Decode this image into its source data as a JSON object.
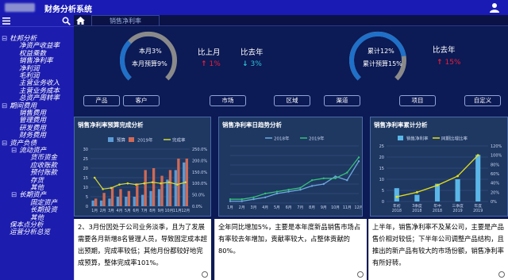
{
  "app": {
    "title": "财务分析系统"
  },
  "tabs": [
    {
      "label": "销售净利率"
    }
  ],
  "sidebar": {
    "items": [
      {
        "label": "杜邦分析",
        "toggle": "⊟",
        "level": 0
      },
      {
        "label": "净资产收益率",
        "level": 1
      },
      {
        "label": "权益乘数",
        "level": 1
      },
      {
        "label": "销售净利率",
        "level": 1
      },
      {
        "label": "净利润",
        "level": 1
      },
      {
        "label": "毛利润",
        "level": 1
      },
      {
        "label": "主营业务收入",
        "level": 1
      },
      {
        "label": "主营业务成本",
        "level": 1
      },
      {
        "label": "总资产周转率",
        "level": 1
      },
      {
        "label": "期间费用",
        "toggle": "⊟",
        "level": 0
      },
      {
        "label": "销售费用",
        "level": 1
      },
      {
        "label": "管理费用",
        "level": 1
      },
      {
        "label": "研发费用",
        "level": 1
      },
      {
        "label": "财务费用",
        "level": 1
      },
      {
        "label": "资产负债",
        "toggle": "⊟",
        "level": 0
      },
      {
        "label": "流动资产",
        "toggle": "⊟",
        "level": 1
      },
      {
        "label": "货币资金",
        "level": 2
      },
      {
        "label": "应收账款",
        "level": 2
      },
      {
        "label": "预付账款",
        "level": 2
      },
      {
        "label": "存货",
        "level": 2
      },
      {
        "label": "其他",
        "level": 2
      },
      {
        "label": "长期资产",
        "toggle": "⊟",
        "level": 1
      },
      {
        "label": "固定资产",
        "level": 2
      },
      {
        "label": "长期投资",
        "level": 2
      },
      {
        "label": "其他",
        "level": 2
      },
      {
        "label": "保本点分析",
        "level": 0
      },
      {
        "label": "运营分析总览",
        "level": 0
      }
    ]
  },
  "kpi_left": {
    "gauge_line1": "本月3%",
    "gauge_line2": "本月预算9%",
    "gauge_progress": 0.33,
    "cmp1_title": "比上月",
    "cmp1_value": "1%",
    "cmp1_dir": "up",
    "cmp2_title": "比去年",
    "cmp2_value": "3%",
    "cmp2_dir": "down"
  },
  "kpi_right": {
    "gauge_line1": "累计12%",
    "gauge_line2": "累计预算15%",
    "gauge_progress": 0.8,
    "cmp1_title": "比去年",
    "cmp1_value": "15%",
    "cmp1_dir": "up"
  },
  "colors": {
    "up": "#e8203a",
    "down": "#2ec3d8",
    "gauge_fill": "#1f70c8",
    "gauge_track": "#8a8a8a"
  },
  "filters": [
    {
      "label": "产品"
    },
    {
      "label": "客户"
    },
    {
      "label": "市场"
    },
    {
      "label": "区域"
    },
    {
      "label": "渠道"
    },
    {
      "label": "项目"
    },
    {
      "label": "自定义"
    }
  ],
  "chart_data": [
    {
      "type": "bar",
      "title": "销售净利率预算完成分析",
      "categories": [
        "1月",
        "2月",
        "3月",
        "4月",
        "5月",
        "6月",
        "7月",
        "8月",
        "9月",
        "10月",
        "11月",
        "12月"
      ],
      "series": [
        {
          "name": "预算",
          "values": [
            3,
            3,
            4,
            5,
            5,
            5,
            6,
            8,
            9,
            14,
            19,
            23
          ]
        },
        {
          "name": "2019年",
          "values": [
            4,
            7,
            10,
            9,
            8,
            12,
            19,
            20,
            16,
            19,
            25,
            25
          ]
        },
        {
          "name": "完成率",
          "values": [
            125,
            75,
            80,
            95,
            100,
            95,
            100,
            105,
            100,
            105,
            95,
            105
          ],
          "axis": "right"
        }
      ],
      "ylim": [
        0,
        30
      ],
      "y2lim": [
        0,
        250
      ],
      "yticks": [
        "0",
        "5",
        "10",
        "15",
        "20",
        "25",
        "30"
      ],
      "y2ticks": [
        "0.0%",
        "50.0%",
        "100.0%",
        "150.0%",
        "200.0%",
        "250.0%"
      ],
      "legend": "top"
    },
    {
      "type": "line",
      "title": "销售净利率日趋势分析",
      "x": [
        "1月",
        "2月",
        "3月",
        "4月",
        "5月",
        "6月",
        "7月",
        "8月",
        "9月",
        "10月",
        "11月",
        "12月"
      ],
      "series": [
        {
          "name": "2018年",
          "values": [
            1,
            1,
            2,
            3,
            5,
            6,
            7,
            9,
            10,
            14,
            12,
            22
          ]
        },
        {
          "name": "2019年",
          "values": [
            2,
            2,
            3,
            5,
            6,
            7,
            8,
            12,
            13,
            13,
            16,
            24
          ]
        }
      ],
      "ylim": [
        0,
        30
      ],
      "legend": "top"
    },
    {
      "type": "bar",
      "title": "销售净利率累计分析",
      "categories": [
        "年初\n2018",
        "3季度\n2018",
        "年中\n2018",
        "三季度\n2019",
        "年度\n2019"
      ],
      "series": [
        {
          "name": "销售净利率",
          "values": [
            6,
            3,
            8,
            10,
            21
          ]
        },
        {
          "name": "同期比增比率",
          "values": [
            10,
            20,
            35,
            55,
            100
          ],
          "axis": "right"
        }
      ],
      "ylim": [
        0,
        25
      ],
      "y2lim": [
        0,
        120
      ],
      "yticks": [
        "0",
        "5",
        "10",
        "15",
        "20",
        "25"
      ],
      "y2ticks": [
        "0%",
        "20%",
        "40%",
        "60%",
        "80%",
        "100%",
        "120%"
      ],
      "legend": "top"
    }
  ],
  "analysis": [
    {
      "text": "2、3月份因处于公司业务淡季，且为了发展需要各月新增8名管理人员，导致固定成本超出预期，完成率较低；其他月份都较好地完成预算，整体完成率101%。"
    },
    {
      "text": "全年同比增加5%，主要是本年度新品销售市场占有率较去年增加，贡献率较大，占整体贡献的80%。"
    },
    {
      "text": "上半年，销售净利率不及某公司，主要是产品售价相对较低；下半年公司调整产品结构，且推出的新产品有较大的市场份额，销售净利率有所好转。"
    }
  ]
}
